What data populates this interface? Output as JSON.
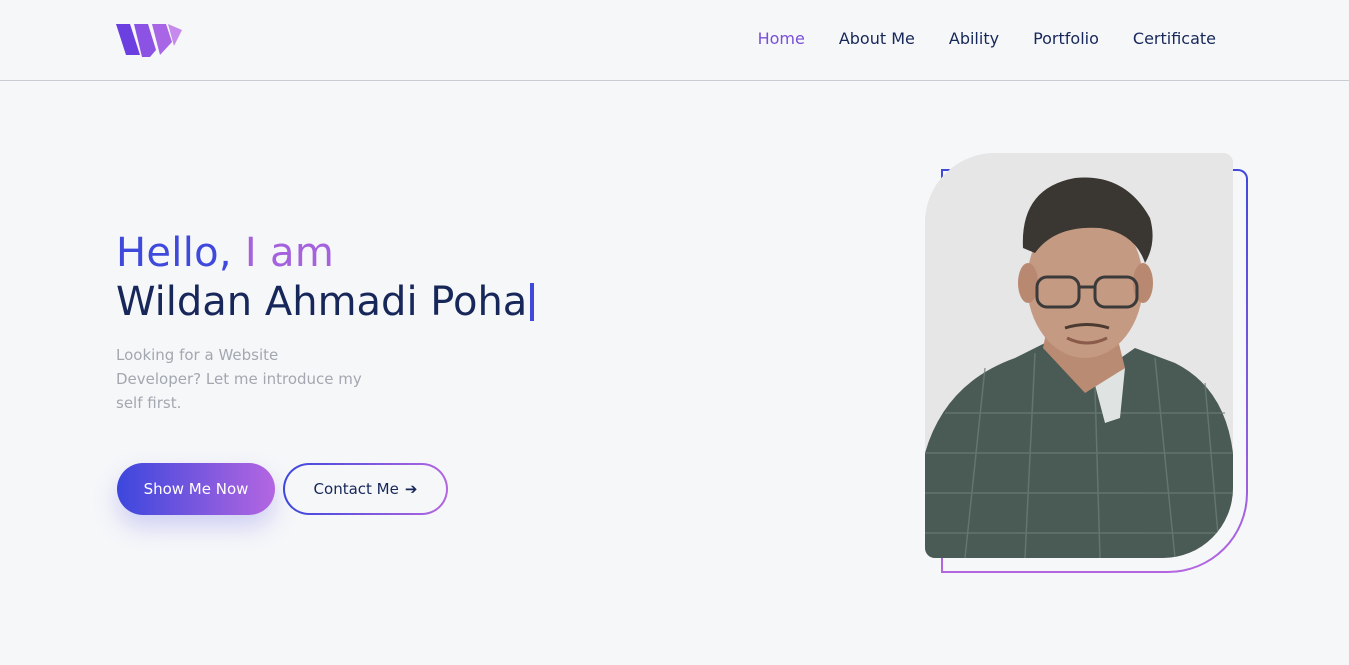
{
  "header": {
    "logo_name": "logo-mark",
    "nav": [
      {
        "label": "Home",
        "active": true
      },
      {
        "label": "About Me",
        "active": false
      },
      {
        "label": "Ability",
        "active": false
      },
      {
        "label": "Portfolio",
        "active": false
      },
      {
        "label": "Certificate",
        "active": false
      }
    ]
  },
  "hero": {
    "greeting_part1": "Hello,",
    "greeting_part2": "I am",
    "name": "Wildan Ahmadi Poha",
    "intro": "Looking for a Website Developer? Let me introduce my self first.",
    "primary_button": "Show Me Now",
    "secondary_button": "Contact Me",
    "secondary_icon": "arrow-right-icon"
  },
  "colors": {
    "accent_blue": "#3f49dc",
    "accent_purple": "#a562dd",
    "text_dark": "#17275a",
    "text_muted": "#a3a7b0",
    "background": "#f6f7f9"
  }
}
